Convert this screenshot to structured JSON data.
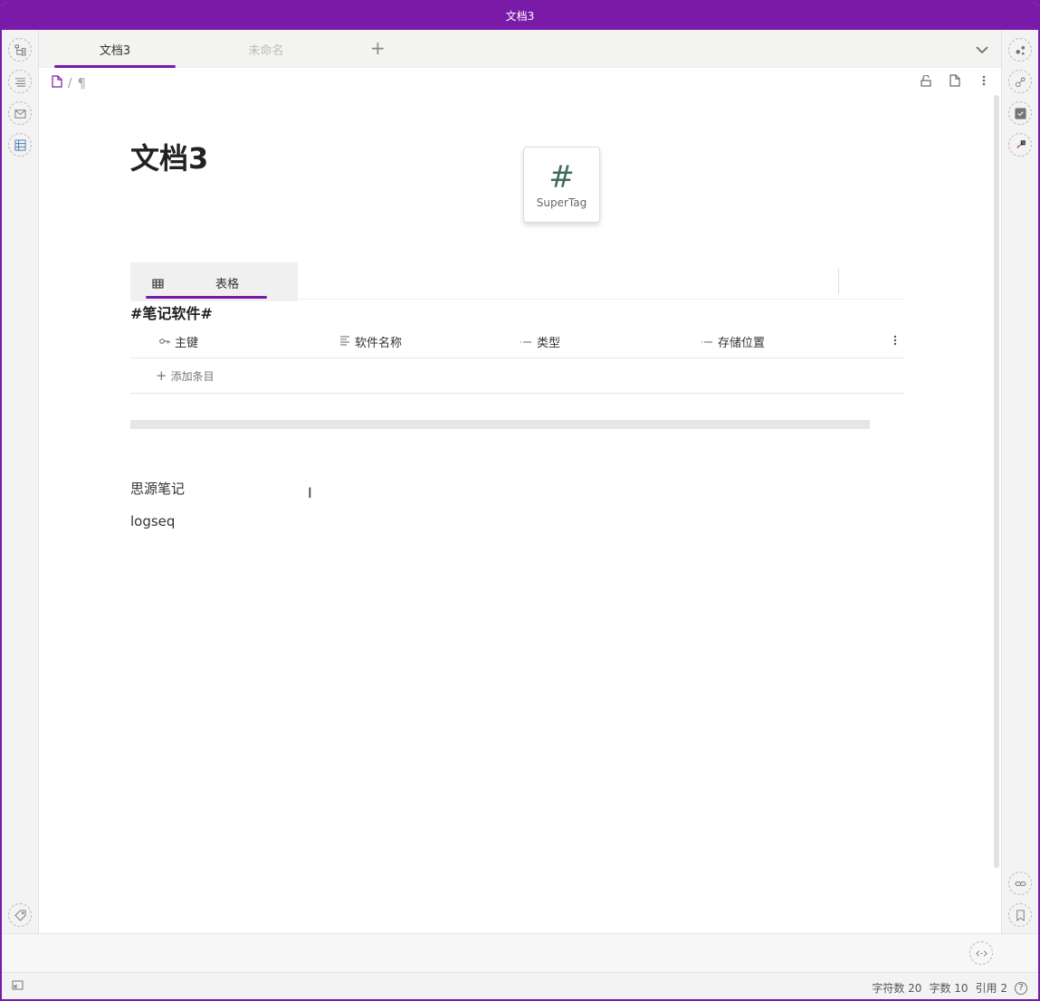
{
  "window": {
    "title": "文档3"
  },
  "tabs": [
    {
      "label": "文档3",
      "active": true
    },
    {
      "label": "未命名",
      "active": false
    }
  ],
  "breadcrumb": {
    "separator": "/",
    "paragraph_glyph": "¶"
  },
  "document": {
    "title": "文档3",
    "supertag_label": "SuperTag",
    "supertag_symbol": "#"
  },
  "database": {
    "view_tab": "表格",
    "name": "#笔记软件#",
    "columns": [
      {
        "label": "主键",
        "icon": "key-icon"
      },
      {
        "label": "软件名称",
        "icon": "text-icon"
      },
      {
        "label": "类型",
        "icon": "select-icon"
      },
      {
        "label": "存储位置",
        "icon": "select-icon"
      }
    ],
    "add_row_label": "添加条目"
  },
  "paragraphs": [
    "思源笔记",
    "logseq"
  ],
  "status": {
    "chars": "字符数 20",
    "words": "字数 10",
    "refs": "引用 2",
    "help": "?"
  },
  "colors": {
    "accent": "#7a1aa8",
    "supertag": "#3f6b60"
  }
}
